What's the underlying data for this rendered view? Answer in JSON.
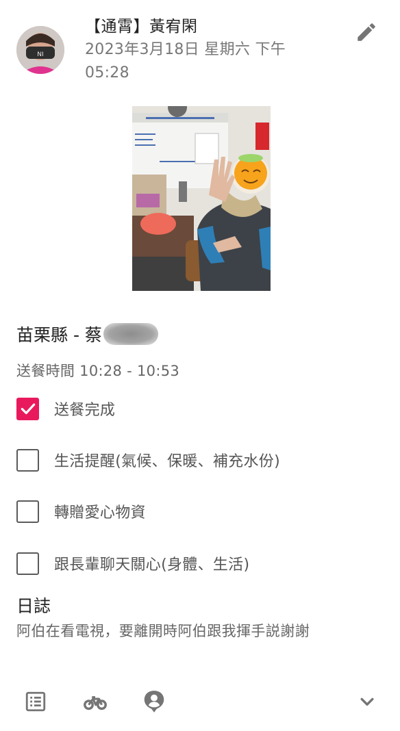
{
  "post": {
    "author": "【通霄】黃宥閑",
    "timestamp": "2023年3月18日 星期六 下午 05:28"
  },
  "location": {
    "label": "苗栗縣 - 蔡"
  },
  "delivery": {
    "time": "送餐時間 10:28 - 10:53"
  },
  "checklist": [
    {
      "label": "送餐完成",
      "checked": true
    },
    {
      "label": "生活提醒(氣候、保暖、補充水份)",
      "checked": false
    },
    {
      "label": "轉贈愛心物資",
      "checked": false
    },
    {
      "label": "跟長輩聊天關心(身體、生活)",
      "checked": false
    }
  ],
  "log": {
    "title": "日誌",
    "text": "阿伯在看電視，要離開時阿伯跟我揮手説謝謝"
  },
  "icons": {
    "edit": "pencil-icon",
    "list": "list-icon",
    "bike": "bicycle-icon",
    "location": "person-pin-icon",
    "expand": "chevron-down-icon"
  },
  "colors": {
    "accent": "#e9195d",
    "secondary_text": "#777777",
    "icon_gray": "#757575"
  }
}
